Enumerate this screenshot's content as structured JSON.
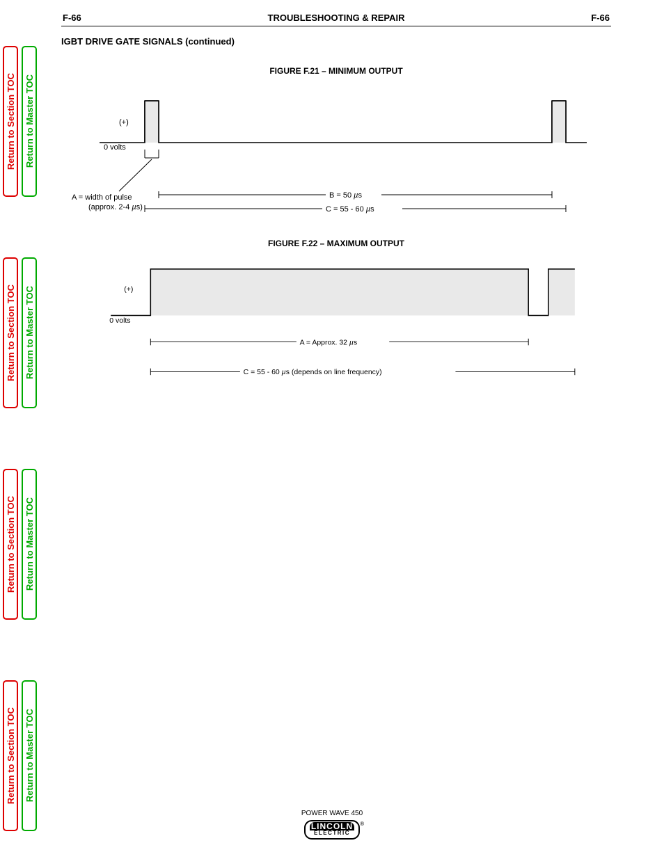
{
  "header": {
    "left": "F-66",
    "center": "TROUBLESHOOTING & REPAIR",
    "right": "F-66"
  },
  "section_title": "IGBT DRIVE GATE SIGNALS (continued)",
  "figures": {
    "fig1": {
      "caption": "FIGURE F.21 – MINIMUM OUTPUT",
      "plus": "(+)",
      "zero": "0 volts",
      "a_desc": "A = width of pulse\n      (approx. 2-4     s)",
      "a_mu": "µ",
      "b_label": "B = 50    s",
      "b_mu": "µ",
      "c_label": "C = 55 - 60    s",
      "c_mu": "µ"
    },
    "fig2": {
      "caption": "FIGURE F.22 – MAXIMUM OUTPUT",
      "plus": "(+)",
      "zero": "0 volts",
      "a_label": "A = Approx. 32    s",
      "a_mu": "µ",
      "c_label": "C = 55 - 60    s (depends on line frequency)",
      "c_mu": "µ"
    }
  },
  "footer": {
    "model": "POWER WAVE 450",
    "logo_top": "LINCOLN",
    "logo_bot": "ELECTRIC",
    "reg": "®"
  },
  "tabs": {
    "section": "Return to Section TOC",
    "master": "Return to Master TOC"
  }
}
